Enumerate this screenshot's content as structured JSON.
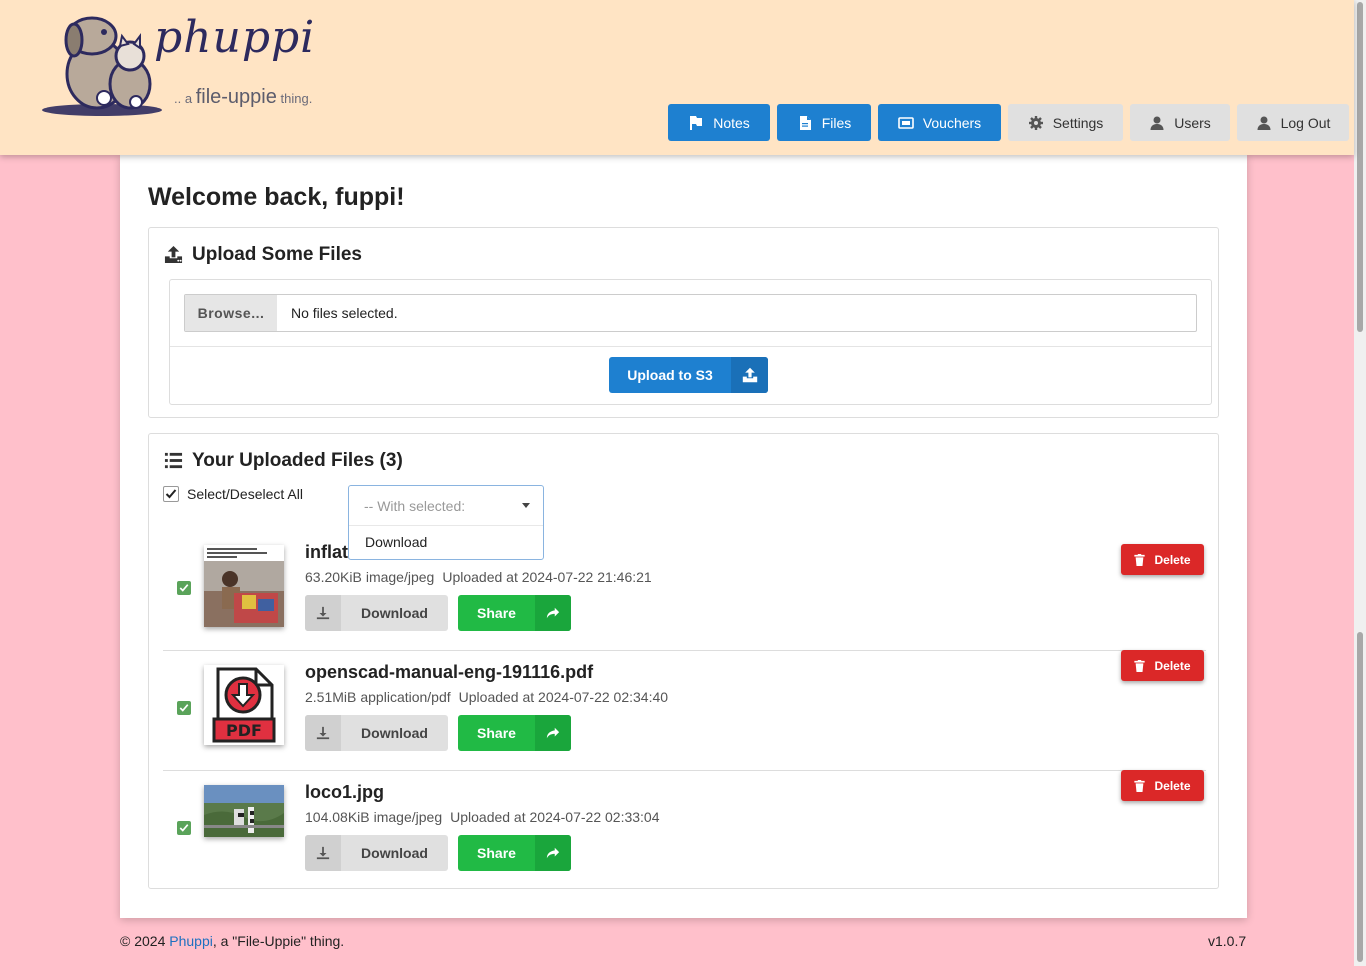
{
  "brand": {
    "name": "phuppi",
    "tagline_prefix": ".. a",
    "tagline_main": "file-uppie",
    "tagline_suffix": "thing."
  },
  "nav": [
    {
      "label": "Notes",
      "icon": "flag-icon",
      "style": "primary"
    },
    {
      "label": "Files",
      "icon": "file-icon",
      "style": "primary"
    },
    {
      "label": "Vouchers",
      "icon": "ticket-icon",
      "style": "primary"
    },
    {
      "label": "Settings",
      "icon": "gear-icon",
      "style": "secondary"
    },
    {
      "label": "Users",
      "icon": "user-icon",
      "style": "secondary"
    },
    {
      "label": "Log Out",
      "icon": "user-icon",
      "style": "secondary"
    }
  ],
  "welcome": "Welcome back, fuppi!",
  "upload": {
    "title": "Upload Some Files",
    "browse_label": "Browse...",
    "no_files": "No files selected.",
    "button_label": "Upload to S3"
  },
  "files_panel": {
    "title": "Your Uploaded Files (3)",
    "select_all_label": "Select/Deselect All",
    "with_selected_placeholder": "-- With selected:",
    "with_selected_options": [
      "Download"
    ]
  },
  "files": [
    {
      "name": "inflat",
      "size": "63.20KiB",
      "type": "image/jpeg",
      "uploaded": "Uploaded at 2024-07-22 21:46:21",
      "checked": true
    },
    {
      "name": "openscad-manual-eng-191116.pdf",
      "size": "2.51MiB",
      "type": "application/pdf",
      "uploaded": "Uploaded at 2024-07-22 02:34:40",
      "checked": true
    },
    {
      "name": "loco1.jpg",
      "size": "104.08KiB",
      "type": "image/jpeg",
      "uploaded": "Uploaded at 2024-07-22 02:33:04",
      "checked": true
    }
  ],
  "file_actions": {
    "download": "Download",
    "share": "Share",
    "delete": "Delete"
  },
  "footer": {
    "copyright_prefix": "© 2024",
    "brand_link": "Phuppi",
    "copyright_suffix": ", a \"File-Uppie\" thing.",
    "version": "v1.0.7"
  },
  "colors": {
    "header_bg": "#ffe4c4",
    "page_bg": "#ffc0cb",
    "primary": "#1e80d0",
    "share": "#21ba45",
    "delete": "#db2828"
  }
}
